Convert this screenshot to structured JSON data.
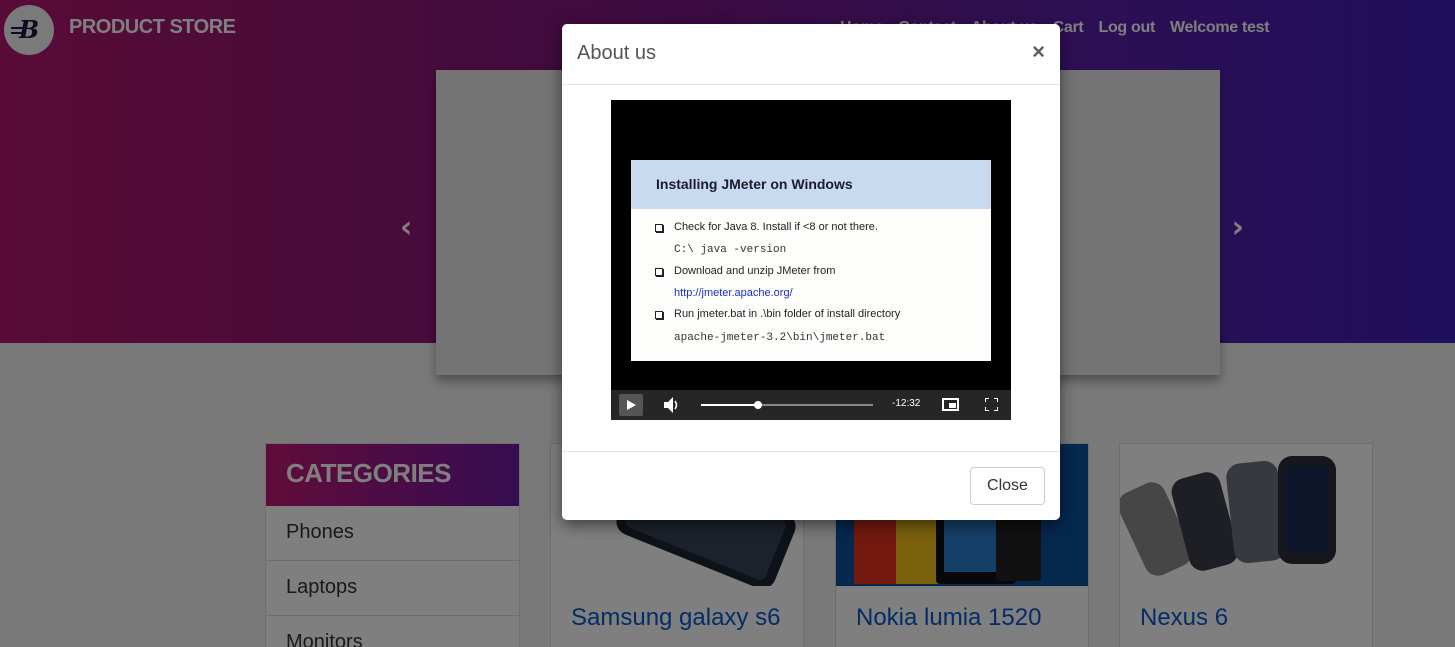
{
  "navbar": {
    "brand_name": "PRODUCT STORE",
    "links": [
      "Home",
      "Contact",
      "About us",
      "Cart",
      "Log out",
      "Welcome test"
    ]
  },
  "categories": {
    "header": "CATEGORIES",
    "items": [
      "Phones",
      "Laptops",
      "Monitors"
    ]
  },
  "products": [
    {
      "title": "Samsung galaxy s6"
    },
    {
      "title": "Nokia lumia 1520"
    },
    {
      "title": "Nexus 6"
    }
  ],
  "modal": {
    "title": "About us",
    "close_symbol": "×",
    "close_button": "Close",
    "video": {
      "slide_title": "Installing JMeter on Windows",
      "lines": [
        "Check for Java 8.  Install if <8 or not there.",
        "C:\\  java -version",
        "Download and unzip JMeter from",
        "http://jmeter.apache.org/",
        "Run jmeter.bat in .\\bin folder of install directory",
        "apache-jmeter-3.2\\bin\\jmeter.bat"
      ],
      "time_remaining": "-12:32",
      "progress_fraction": 0.33
    }
  }
}
